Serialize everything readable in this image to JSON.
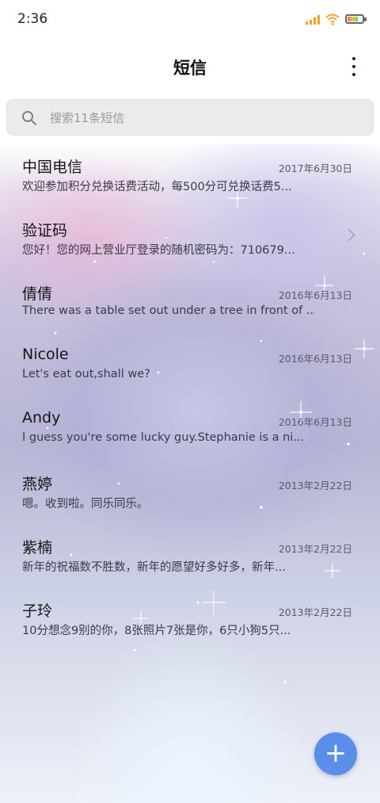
{
  "status": {
    "time": "2:36"
  },
  "header": {
    "title": "短信",
    "more_icon": "more-vertical-icon"
  },
  "search": {
    "placeholder": "搜索11条短信",
    "icon": "search-icon"
  },
  "conversations": [
    {
      "name": "中国电信",
      "date": "2017年6月30日",
      "preview": "欢迎参加积分兑换话费活动，每500分可兑换话费5..."
    },
    {
      "name": "验证码",
      "date": "",
      "preview": "您好！您的网上营业厅登录的随机密码为：710679..."
    },
    {
      "name": "倩倩",
      "date": "2016年6月13日",
      "preview": "There was a table set out under a tree in front of ..."
    },
    {
      "name": "Nicole",
      "date": "2016年6月13日",
      "preview": "Let's eat out,shall we?"
    },
    {
      "name": "Andy",
      "date": "2016年6月13日",
      "preview": "I guess you're some lucky guy.Stephanie is a ni..."
    },
    {
      "name": "燕婷",
      "date": "2013年2月22日",
      "preview": "嗯。收到啦。同乐同乐。"
    },
    {
      "name": "紫楠",
      "date": "2013年2月22日",
      "preview": "新年的祝福数不胜数，新年的愿望好多好多，新年..."
    },
    {
      "name": "子玲",
      "date": "2013年2月22日",
      "preview": "10分想念9别的你，8张照片7张是你，6只小狗5只..."
    }
  ],
  "fab": {
    "label": "+",
    "color": "#5b8ee8"
  }
}
